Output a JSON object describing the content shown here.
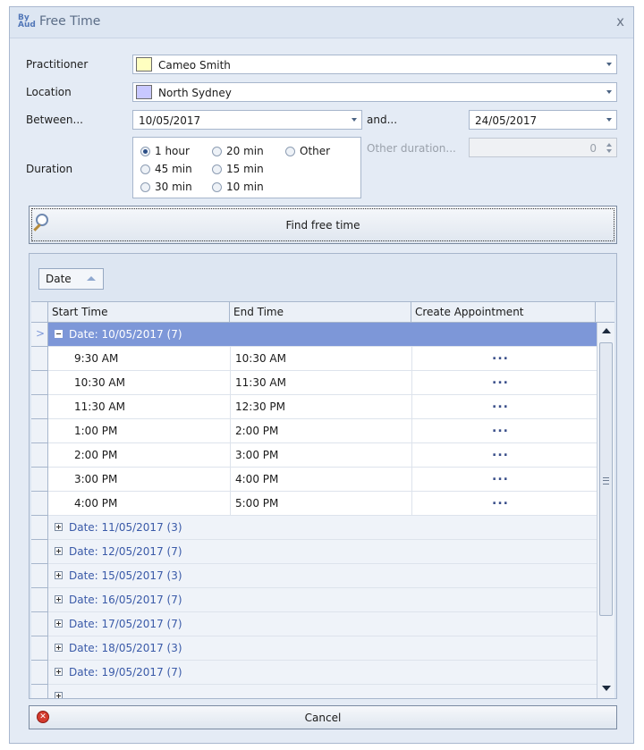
{
  "window": {
    "title": "Free Time",
    "icon": "app-logo-icon",
    "close": "x"
  },
  "form": {
    "practitioner_label": "Practitioner",
    "practitioner_value": "Cameo Smith",
    "practitioner_color": "#ffffc0",
    "location_label": "Location",
    "location_value": "North Sydney",
    "location_color": "#c8c8ff",
    "between_label": "Between...",
    "between_value": "10/05/2017",
    "and_label": "and...",
    "and_value": "24/05/2017",
    "duration_label": "Duration",
    "durations": [
      {
        "label": "1 hour",
        "checked": true
      },
      {
        "label": "20 min",
        "checked": false
      },
      {
        "label": "Other",
        "checked": false
      },
      {
        "label": "45 min",
        "checked": false
      },
      {
        "label": "15 min",
        "checked": false
      },
      {
        "label": "30 min",
        "checked": false
      },
      {
        "label": "10 min",
        "checked": false
      }
    ],
    "other_duration_label": "Other duration...",
    "other_duration_value": "0"
  },
  "find_button": {
    "label": "Find free time",
    "icon": "magnifier-icon"
  },
  "grid": {
    "group_by": "Date",
    "columns": [
      "Start Time",
      "End Time",
      "Create Appointment"
    ],
    "expanded_group": "Date: 10/05/2017 (7)",
    "rows": [
      {
        "start": "9:30 AM",
        "end": "10:30 AM",
        "action": "..."
      },
      {
        "start": "10:30 AM",
        "end": "11:30 AM",
        "action": "..."
      },
      {
        "start": "11:30 AM",
        "end": "12:30 PM",
        "action": "..."
      },
      {
        "start": "1:00 PM",
        "end": "2:00 PM",
        "action": "..."
      },
      {
        "start": "2:00 PM",
        "end": "3:00 PM",
        "action": "..."
      },
      {
        "start": "3:00 PM",
        "end": "4:00 PM",
        "action": "..."
      },
      {
        "start": "4:00 PM",
        "end": "5:00 PM",
        "action": "..."
      }
    ],
    "collapsed_groups": [
      "Date: 11/05/2017 (3)",
      "Date: 12/05/2017 (7)",
      "Date: 15/05/2017 (3)",
      "Date: 16/05/2017 (7)",
      "Date: 17/05/2017 (7)",
      "Date: 18/05/2017 (3)",
      "Date: 19/05/2017 (7)"
    ]
  },
  "cancel_button": {
    "label": "Cancel",
    "icon": "cancel-icon"
  },
  "colors": {
    "selected_group": "#7d97d8",
    "group_text": "#3a5aa8",
    "window_bg": "#e4ebf5"
  }
}
